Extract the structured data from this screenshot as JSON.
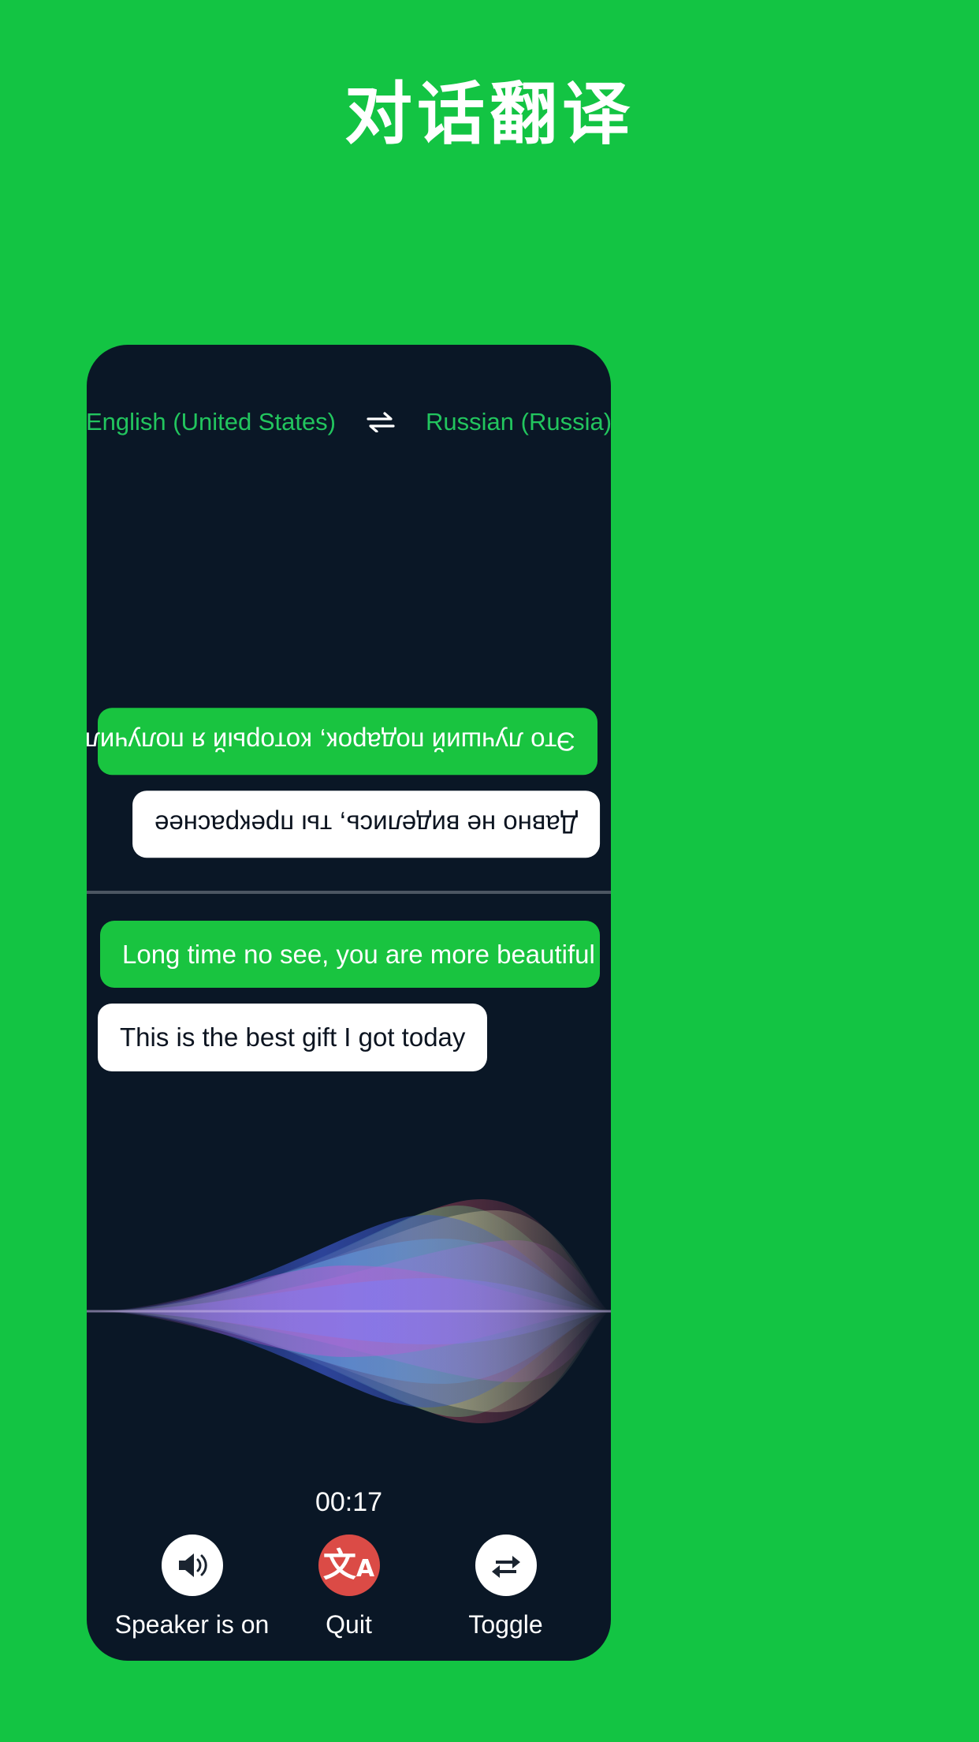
{
  "page": {
    "title": "对话翻译",
    "background_color": "#13C443",
    "card_color": "#0A1726"
  },
  "language_bar": {
    "source": "English (United States)",
    "swap_icon": "swap-horizontal-icon",
    "target": "Russian (Russia)",
    "accent_color": "#22C55E"
  },
  "transcript": {
    "foreign_pane": {
      "orientation": "rotated-180",
      "messages": [
        {
          "text": "Это лучший подарок, который я получил сегодня",
          "style": "green",
          "align": "left"
        },
        {
          "text": "Давно не виделись, ты прекраснее",
          "style": "white",
          "align": "right"
        }
      ]
    },
    "native_pane": {
      "orientation": "normal",
      "messages": [
        {
          "text": "Long time no see, you are more beautiful",
          "style": "green",
          "align": "right"
        },
        {
          "text": "This is the best gift I got today",
          "style": "white",
          "align": "left"
        }
      ]
    }
  },
  "waveform": {
    "description": "siri-style-audio-waveform",
    "colors": [
      "#2E3FB0",
      "#5B8FD6",
      "#7F6BE8",
      "#B94BC9",
      "#C9BE8C",
      "#8E2E38",
      "#5E9E5E"
    ]
  },
  "timer": {
    "value": "00:17"
  },
  "controls": [
    {
      "icon": "speaker-on-icon",
      "label": "Speaker is on",
      "circle": "#FFFFFF",
      "glyph_color": "#1B2430"
    },
    {
      "icon": "translate-icon",
      "label": "Quit",
      "circle": "#DB4B46",
      "glyph_color": "#FFFFFF"
    },
    {
      "icon": "toggle-repeat-icon",
      "label": "Toggle",
      "circle": "#FFFFFF",
      "glyph_color": "#1B2430"
    }
  ]
}
